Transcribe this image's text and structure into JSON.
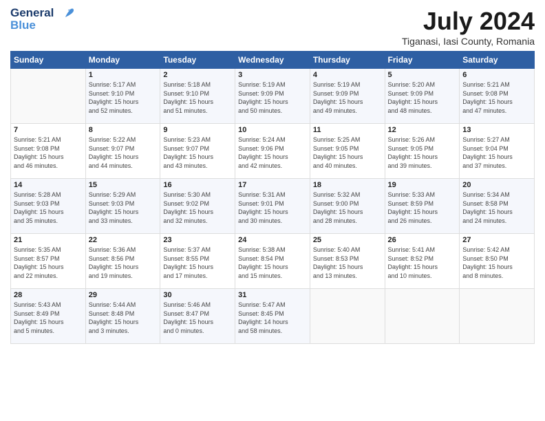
{
  "logo": {
    "line1": "General",
    "line2": "Blue"
  },
  "title": "July 2024",
  "location": "Tiganasi, Iasi County, Romania",
  "header": {
    "days": [
      "Sunday",
      "Monday",
      "Tuesday",
      "Wednesday",
      "Thursday",
      "Friday",
      "Saturday"
    ]
  },
  "weeks": [
    [
      {
        "num": "",
        "info": ""
      },
      {
        "num": "1",
        "info": "Sunrise: 5:17 AM\nSunset: 9:10 PM\nDaylight: 15 hours\nand 52 minutes."
      },
      {
        "num": "2",
        "info": "Sunrise: 5:18 AM\nSunset: 9:10 PM\nDaylight: 15 hours\nand 51 minutes."
      },
      {
        "num": "3",
        "info": "Sunrise: 5:19 AM\nSunset: 9:09 PM\nDaylight: 15 hours\nand 50 minutes."
      },
      {
        "num": "4",
        "info": "Sunrise: 5:19 AM\nSunset: 9:09 PM\nDaylight: 15 hours\nand 49 minutes."
      },
      {
        "num": "5",
        "info": "Sunrise: 5:20 AM\nSunset: 9:09 PM\nDaylight: 15 hours\nand 48 minutes."
      },
      {
        "num": "6",
        "info": "Sunrise: 5:21 AM\nSunset: 9:08 PM\nDaylight: 15 hours\nand 47 minutes."
      }
    ],
    [
      {
        "num": "7",
        "info": "Sunrise: 5:21 AM\nSunset: 9:08 PM\nDaylight: 15 hours\nand 46 minutes."
      },
      {
        "num": "8",
        "info": "Sunrise: 5:22 AM\nSunset: 9:07 PM\nDaylight: 15 hours\nand 44 minutes."
      },
      {
        "num": "9",
        "info": "Sunrise: 5:23 AM\nSunset: 9:07 PM\nDaylight: 15 hours\nand 43 minutes."
      },
      {
        "num": "10",
        "info": "Sunrise: 5:24 AM\nSunset: 9:06 PM\nDaylight: 15 hours\nand 42 minutes."
      },
      {
        "num": "11",
        "info": "Sunrise: 5:25 AM\nSunset: 9:05 PM\nDaylight: 15 hours\nand 40 minutes."
      },
      {
        "num": "12",
        "info": "Sunrise: 5:26 AM\nSunset: 9:05 PM\nDaylight: 15 hours\nand 39 minutes."
      },
      {
        "num": "13",
        "info": "Sunrise: 5:27 AM\nSunset: 9:04 PM\nDaylight: 15 hours\nand 37 minutes."
      }
    ],
    [
      {
        "num": "14",
        "info": "Sunrise: 5:28 AM\nSunset: 9:03 PM\nDaylight: 15 hours\nand 35 minutes."
      },
      {
        "num": "15",
        "info": "Sunrise: 5:29 AM\nSunset: 9:03 PM\nDaylight: 15 hours\nand 33 minutes."
      },
      {
        "num": "16",
        "info": "Sunrise: 5:30 AM\nSunset: 9:02 PM\nDaylight: 15 hours\nand 32 minutes."
      },
      {
        "num": "17",
        "info": "Sunrise: 5:31 AM\nSunset: 9:01 PM\nDaylight: 15 hours\nand 30 minutes."
      },
      {
        "num": "18",
        "info": "Sunrise: 5:32 AM\nSunset: 9:00 PM\nDaylight: 15 hours\nand 28 minutes."
      },
      {
        "num": "19",
        "info": "Sunrise: 5:33 AM\nSunset: 8:59 PM\nDaylight: 15 hours\nand 26 minutes."
      },
      {
        "num": "20",
        "info": "Sunrise: 5:34 AM\nSunset: 8:58 PM\nDaylight: 15 hours\nand 24 minutes."
      }
    ],
    [
      {
        "num": "21",
        "info": "Sunrise: 5:35 AM\nSunset: 8:57 PM\nDaylight: 15 hours\nand 22 minutes."
      },
      {
        "num": "22",
        "info": "Sunrise: 5:36 AM\nSunset: 8:56 PM\nDaylight: 15 hours\nand 19 minutes."
      },
      {
        "num": "23",
        "info": "Sunrise: 5:37 AM\nSunset: 8:55 PM\nDaylight: 15 hours\nand 17 minutes."
      },
      {
        "num": "24",
        "info": "Sunrise: 5:38 AM\nSunset: 8:54 PM\nDaylight: 15 hours\nand 15 minutes."
      },
      {
        "num": "25",
        "info": "Sunrise: 5:40 AM\nSunset: 8:53 PM\nDaylight: 15 hours\nand 13 minutes."
      },
      {
        "num": "26",
        "info": "Sunrise: 5:41 AM\nSunset: 8:52 PM\nDaylight: 15 hours\nand 10 minutes."
      },
      {
        "num": "27",
        "info": "Sunrise: 5:42 AM\nSunset: 8:50 PM\nDaylight: 15 hours\nand 8 minutes."
      }
    ],
    [
      {
        "num": "28",
        "info": "Sunrise: 5:43 AM\nSunset: 8:49 PM\nDaylight: 15 hours\nand 5 minutes."
      },
      {
        "num": "29",
        "info": "Sunrise: 5:44 AM\nSunset: 8:48 PM\nDaylight: 15 hours\nand 3 minutes."
      },
      {
        "num": "30",
        "info": "Sunrise: 5:46 AM\nSunset: 8:47 PM\nDaylight: 15 hours\nand 0 minutes."
      },
      {
        "num": "31",
        "info": "Sunrise: 5:47 AM\nSunset: 8:45 PM\nDaylight: 14 hours\nand 58 minutes."
      },
      {
        "num": "",
        "info": ""
      },
      {
        "num": "",
        "info": ""
      },
      {
        "num": "",
        "info": ""
      }
    ]
  ]
}
